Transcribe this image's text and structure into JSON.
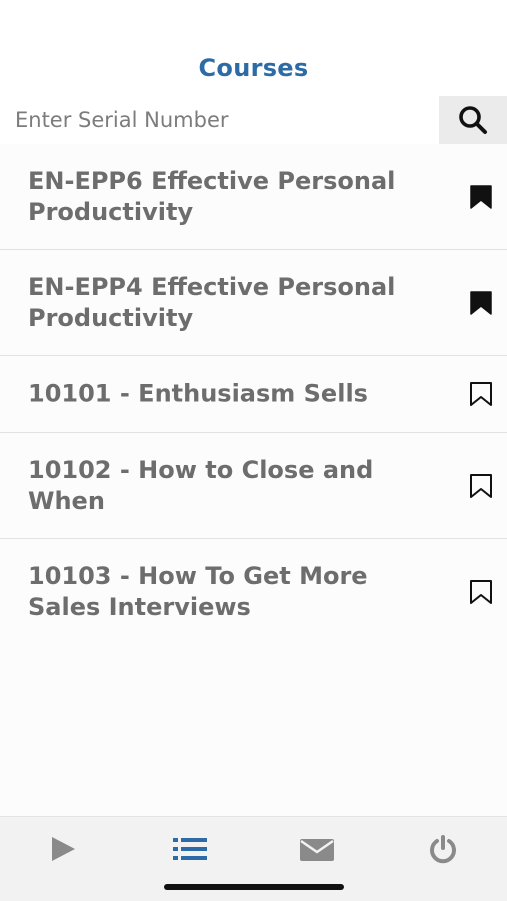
{
  "header": {
    "title": "Courses"
  },
  "search": {
    "placeholder": "Enter Serial Number",
    "value": ""
  },
  "courses": [
    {
      "title": "EN-EPP6 Effective Personal Productivity",
      "bookmarked": true
    },
    {
      "title": "EN-EPP4 Effective Personal Productivity",
      "bookmarked": true
    },
    {
      "title": "10101 - Enthusiasm Sells",
      "bookmarked": false
    },
    {
      "title": "10102 - How to Close and When",
      "bookmarked": false
    },
    {
      "title": "10103 - How To Get More Sales Interviews",
      "bookmarked": false
    }
  ],
  "tabbar": {
    "tabs": [
      {
        "icon": "play-icon",
        "active": false
      },
      {
        "icon": "list-icon",
        "active": true
      },
      {
        "icon": "mail-icon",
        "active": false
      },
      {
        "icon": "power-icon",
        "active": false
      }
    ]
  },
  "colors": {
    "accent": "#2d6ba7",
    "text": "#6d6d6d",
    "inactive_icon": "#8a8a8a"
  }
}
